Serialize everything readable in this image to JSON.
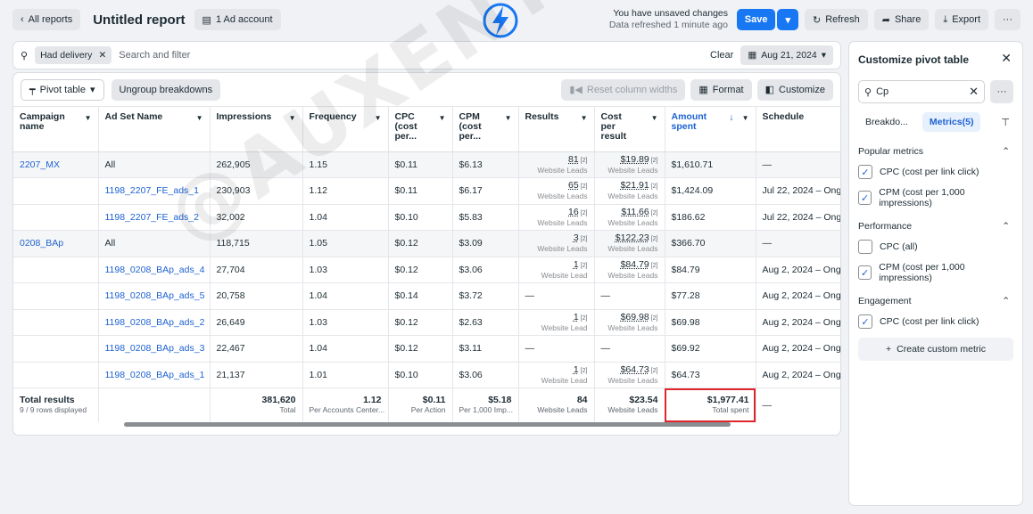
{
  "topbar": {
    "back_label": "All reports",
    "title": "Untitled report",
    "account_label": "1 Ad account",
    "unsaved": "You have unsaved changes",
    "refreshed": "Data refreshed 1 minute ago",
    "save_label": "Save",
    "refresh_label": "Refresh",
    "share_label": "Share",
    "export_label": "Export",
    "more_label": "···"
  },
  "filter": {
    "chip_label": "Had delivery",
    "placeholder": "Search and filter",
    "clear_label": "Clear",
    "date_label": "Aug 21, 2024"
  },
  "toolbar": {
    "pivot_label": "Pivot table",
    "ungroup_label": "Ungroup breakdowns",
    "reset_label": "Reset column widths",
    "format_label": "Format",
    "customize_label": "Customize"
  },
  "columns": [
    "Campaign name",
    "Ad Set Name",
    "Impressions",
    "Frequency",
    "CPC (cost per...",
    "CPM (cost per...",
    "Results",
    "Cost per result",
    "Amount spent",
    "Schedule"
  ],
  "rows": [
    {
      "group": true,
      "campaign": "2207_MX",
      "adset": "All",
      "impressions": "262,905",
      "frequency": "1.15",
      "cpc": "$0.11",
      "cpm": "$6.13",
      "results": "81",
      "results_sub": "Website Leads",
      "cpr": "$19.89",
      "cpr_sub": "Website Leads",
      "spent": "$1,610.71",
      "schedule": "—"
    },
    {
      "group": false,
      "campaign": "",
      "adset": "1198_2207_FE_ads_1",
      "impressions": "230,903",
      "frequency": "1.12",
      "cpc": "$0.11",
      "cpm": "$6.17",
      "results": "65",
      "results_sub": "Website Leads",
      "cpr": "$21.91",
      "cpr_sub": "Website Leads",
      "spent": "$1,424.09",
      "schedule": "Jul 22, 2024 – Ong"
    },
    {
      "group": false,
      "campaign": "",
      "adset": "1198_2207_FE_ads_2",
      "impressions": "32,002",
      "frequency": "1.04",
      "cpc": "$0.10",
      "cpm": "$5.83",
      "results": "16",
      "results_sub": "Website Leads",
      "cpr": "$11.66",
      "cpr_sub": "Website Leads",
      "spent": "$186.62",
      "schedule": "Jul 22, 2024 – Ong"
    },
    {
      "group": true,
      "campaign": "0208_BAp",
      "adset": "All",
      "impressions": "118,715",
      "frequency": "1.05",
      "cpc": "$0.12",
      "cpm": "$3.09",
      "results": "3",
      "results_sub": "Website Leads",
      "cpr": "$122.23",
      "cpr_sub": "Website Leads",
      "spent": "$366.70",
      "schedule": "—"
    },
    {
      "group": false,
      "campaign": "",
      "adset": "1198_0208_BAp_ads_4",
      "impressions": "27,704",
      "frequency": "1.03",
      "cpc": "$0.12",
      "cpm": "$3.06",
      "results": "1",
      "results_sub": "Website Lead",
      "cpr": "$84.79",
      "cpr_sub": "Website Leads",
      "spent": "$84.79",
      "schedule": "Aug 2, 2024 – Ong"
    },
    {
      "group": false,
      "campaign": "",
      "adset": "1198_0208_BAp_ads_5",
      "impressions": "20,758",
      "frequency": "1.04",
      "cpc": "$0.14",
      "cpm": "$3.72",
      "results": "—",
      "results_sub": "",
      "cpr": "—",
      "cpr_sub": "",
      "spent": "$77.28",
      "schedule": "Aug 2, 2024 – Ong"
    },
    {
      "group": false,
      "campaign": "",
      "adset": "1198_0208_BAp_ads_2",
      "impressions": "26,649",
      "frequency": "1.03",
      "cpc": "$0.12",
      "cpm": "$2.63",
      "results": "1",
      "results_sub": "Website Lead",
      "cpr": "$69.98",
      "cpr_sub": "Website Leads",
      "spent": "$69.98",
      "schedule": "Aug 2, 2024 – Ong"
    },
    {
      "group": false,
      "campaign": "",
      "adset": "1198_0208_BAp_ads_3",
      "impressions": "22,467",
      "frequency": "1.04",
      "cpc": "$0.12",
      "cpm": "$3.11",
      "results": "—",
      "results_sub": "",
      "cpr": "—",
      "cpr_sub": "",
      "spent": "$69.92",
      "schedule": "Aug 2, 2024 – Ong"
    },
    {
      "group": false,
      "campaign": "",
      "adset": "1198_0208_BAp_ads_1",
      "impressions": "21,137",
      "frequency": "1.01",
      "cpc": "$0.10",
      "cpm": "$3.06",
      "results": "1",
      "results_sub": "Website Lead",
      "cpr": "$64.73",
      "cpr_sub": "Website Leads",
      "spent": "$64.73",
      "schedule": "Aug 2, 2024 – Ong"
    }
  ],
  "totals": {
    "label": "Total results",
    "rows_displayed": "9 / 9 rows displayed",
    "impressions": "381,620",
    "impressions_sub": "Total",
    "frequency": "1.12",
    "frequency_sub": "Per Accounts Center...",
    "cpc": "$0.11",
    "cpc_sub": "Per Action",
    "cpm": "$5.18",
    "cpm_sub": "Per 1,000 Imp...",
    "results": "84",
    "results_sub": "Website Leads",
    "cpr": "$23.54",
    "cpr_sub": "Website Leads",
    "spent": "$1,977.41",
    "spent_sub": "Total spent",
    "schedule": "—"
  },
  "panel": {
    "title": "Customize pivot table",
    "search_value": "Cp",
    "tab_breakdowns": "Breakdo...",
    "tab_metrics": "Metrics(5)",
    "sections": [
      {
        "label": "Popular metrics",
        "options": [
          {
            "label": "CPC (cost per link click)",
            "checked": true
          },
          {
            "label": "CPM (cost per 1,000 impressions)",
            "checked": true
          }
        ]
      },
      {
        "label": "Performance",
        "options": [
          {
            "label": "CPC (all)",
            "checked": false
          },
          {
            "label": "CPM (cost per 1,000 impressions)",
            "checked": true
          }
        ]
      },
      {
        "label": "Engagement",
        "options": [
          {
            "label": "CPC (cost per link click)",
            "checked": true
          }
        ]
      }
    ],
    "custom_label": "Create custom metric"
  },
  "watermark": "@AUXENTIUS",
  "colors": {
    "accent": "#1877f2",
    "link": "#1d62d1",
    "highlight": "#e0262b"
  }
}
